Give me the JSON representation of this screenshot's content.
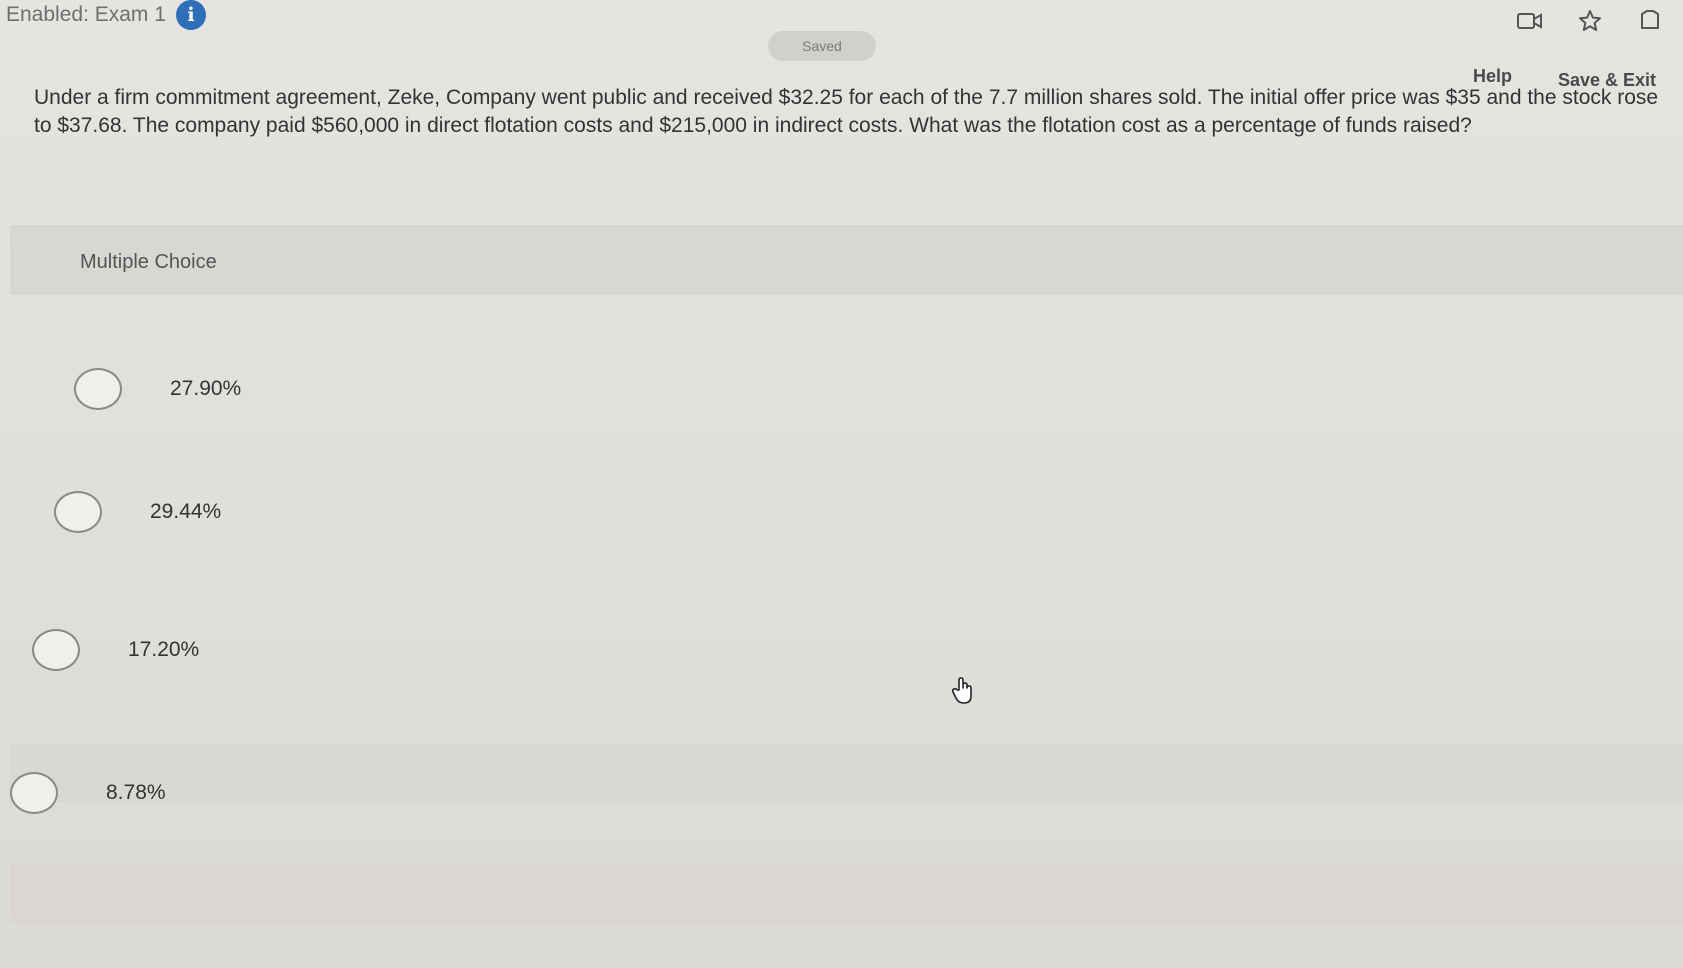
{
  "header": {
    "exam_title": "Enabled: Exam 1",
    "status": "Saved",
    "help_label": "Help",
    "save_exit_label": "Save & Exit"
  },
  "question": {
    "text": "Under a firm commitment agreement, Zeke, Company went public and received $32.25 for each of the 7.7 million shares sold. The initial offer price was $35 and the stock rose to $37.68. The company paid $560,000 in direct flotation costs and $215,000 in indirect costs. What was the flotation cost as a percentage of funds raised?"
  },
  "choices": {
    "heading": "Multiple Choice",
    "options": [
      {
        "label": "27.90%",
        "selected": false
      },
      {
        "label": "29.44%",
        "selected": false
      },
      {
        "label": "17.20%",
        "selected": false
      },
      {
        "label": "8.78%",
        "selected": false
      }
    ]
  },
  "icons": {
    "info": "info-icon",
    "video": "video-icon",
    "star": "star-icon",
    "flag": "flag-icon",
    "cursor": "hand-cursor-icon"
  },
  "colors": {
    "info_blue": "#2f6fb8",
    "background": "#e2e0dc"
  }
}
